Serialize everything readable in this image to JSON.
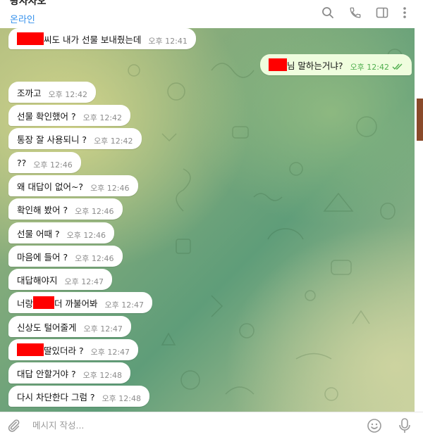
{
  "header": {
    "title": "왕사자오",
    "status": "온라인",
    "icons": [
      "search-icon",
      "phone-icon",
      "sidebar-toggle-icon",
      "more-vert-icon"
    ]
  },
  "colors": {
    "accent": "#3390ec",
    "incoming_bubble": "#ffffff",
    "outgoing_bubble": "#effdde",
    "outgoing_time": "#4fae4e",
    "redaction": "#ff0000"
  },
  "messages": [
    {
      "dir": "in",
      "redact_before": true,
      "text": "씨도 내가 선물 보내줬는데",
      "time": "오후 12:41"
    },
    {
      "dir": "out",
      "redact_before": true,
      "text": "님 말하는거냐?",
      "time": "오후 12:42",
      "read": true
    },
    {
      "dir": "in",
      "text": "조까고",
      "time": "오후 12:42"
    },
    {
      "dir": "in",
      "text": "선물 확인했어 ?",
      "time": "오후 12:42"
    },
    {
      "dir": "in",
      "text": "통장 잘 사용되니 ?",
      "time": "오후 12:42"
    },
    {
      "dir": "in",
      "text": "??",
      "time": "오후 12:46"
    },
    {
      "dir": "in",
      "text": "왜 대답이 없어~?",
      "time": "오후 12:46"
    },
    {
      "dir": "in",
      "text": "확인해 봤어 ?",
      "time": "오후 12:46"
    },
    {
      "dir": "in",
      "text": "선물 어때 ?",
      "time": "오후 12:46"
    },
    {
      "dir": "in",
      "text": "마음에 들어 ?",
      "time": "오후 12:46"
    },
    {
      "dir": "in",
      "text": "대답해야지",
      "time": "오후 12:47"
    },
    {
      "dir": "in",
      "text_before": "너랑",
      "redact_middle": true,
      "text": "더 까불어봐",
      "time": "오후 12:47"
    },
    {
      "dir": "in",
      "text": "신상도 털어줄게",
      "time": "오후 12:47"
    },
    {
      "dir": "in",
      "redact_before": true,
      "text": "딸있더라 ?",
      "time": "오후 12:47"
    },
    {
      "dir": "in",
      "text": "대답 안할거야 ?",
      "time": "오후 12:48"
    },
    {
      "dir": "in",
      "text": "다시 차단한다 그럼 ?",
      "time": "오후 12:48"
    }
  ],
  "composer": {
    "placeholder": "메시지 작성..."
  }
}
